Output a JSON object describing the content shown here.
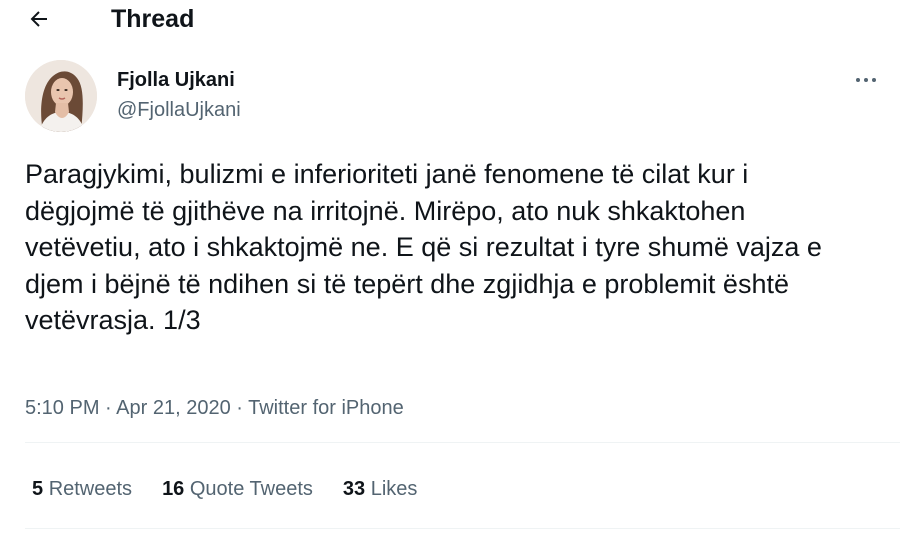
{
  "header": {
    "title": "Thread",
    "back_icon": "arrow-left-icon"
  },
  "author": {
    "name": "Fjolla Ujkani",
    "handle": "@FjollaUjkani",
    "avatar_icon": "profile-photo"
  },
  "tweet": {
    "text": "Paragjykimi, bulizmi e inferioriteti janë fenomene të cilat kur i dëgjojmë të gjithëve na irritojnë. Mirëpo, ato nuk shkaktohen vetëvetiu, ato i shkaktojmë ne. E që si rezultat i tyre shumë vajza e djem i bëjnë të ndihen si të tepërt dhe zgjidhja e problemit është vetëvrasja. 1/3",
    "time": "5:10 PM",
    "date": "Apr 21, 2020",
    "source": "Twitter for iPhone",
    "separator": " · "
  },
  "stats": {
    "retweets_count": "5",
    "retweets_label": "Retweets",
    "quotes_count": "16",
    "quotes_label": "Quote Tweets",
    "likes_count": "33",
    "likes_label": "Likes"
  },
  "colors": {
    "text_primary": "#0f1419",
    "text_secondary": "#536471",
    "divider": "#eff3f4"
  }
}
